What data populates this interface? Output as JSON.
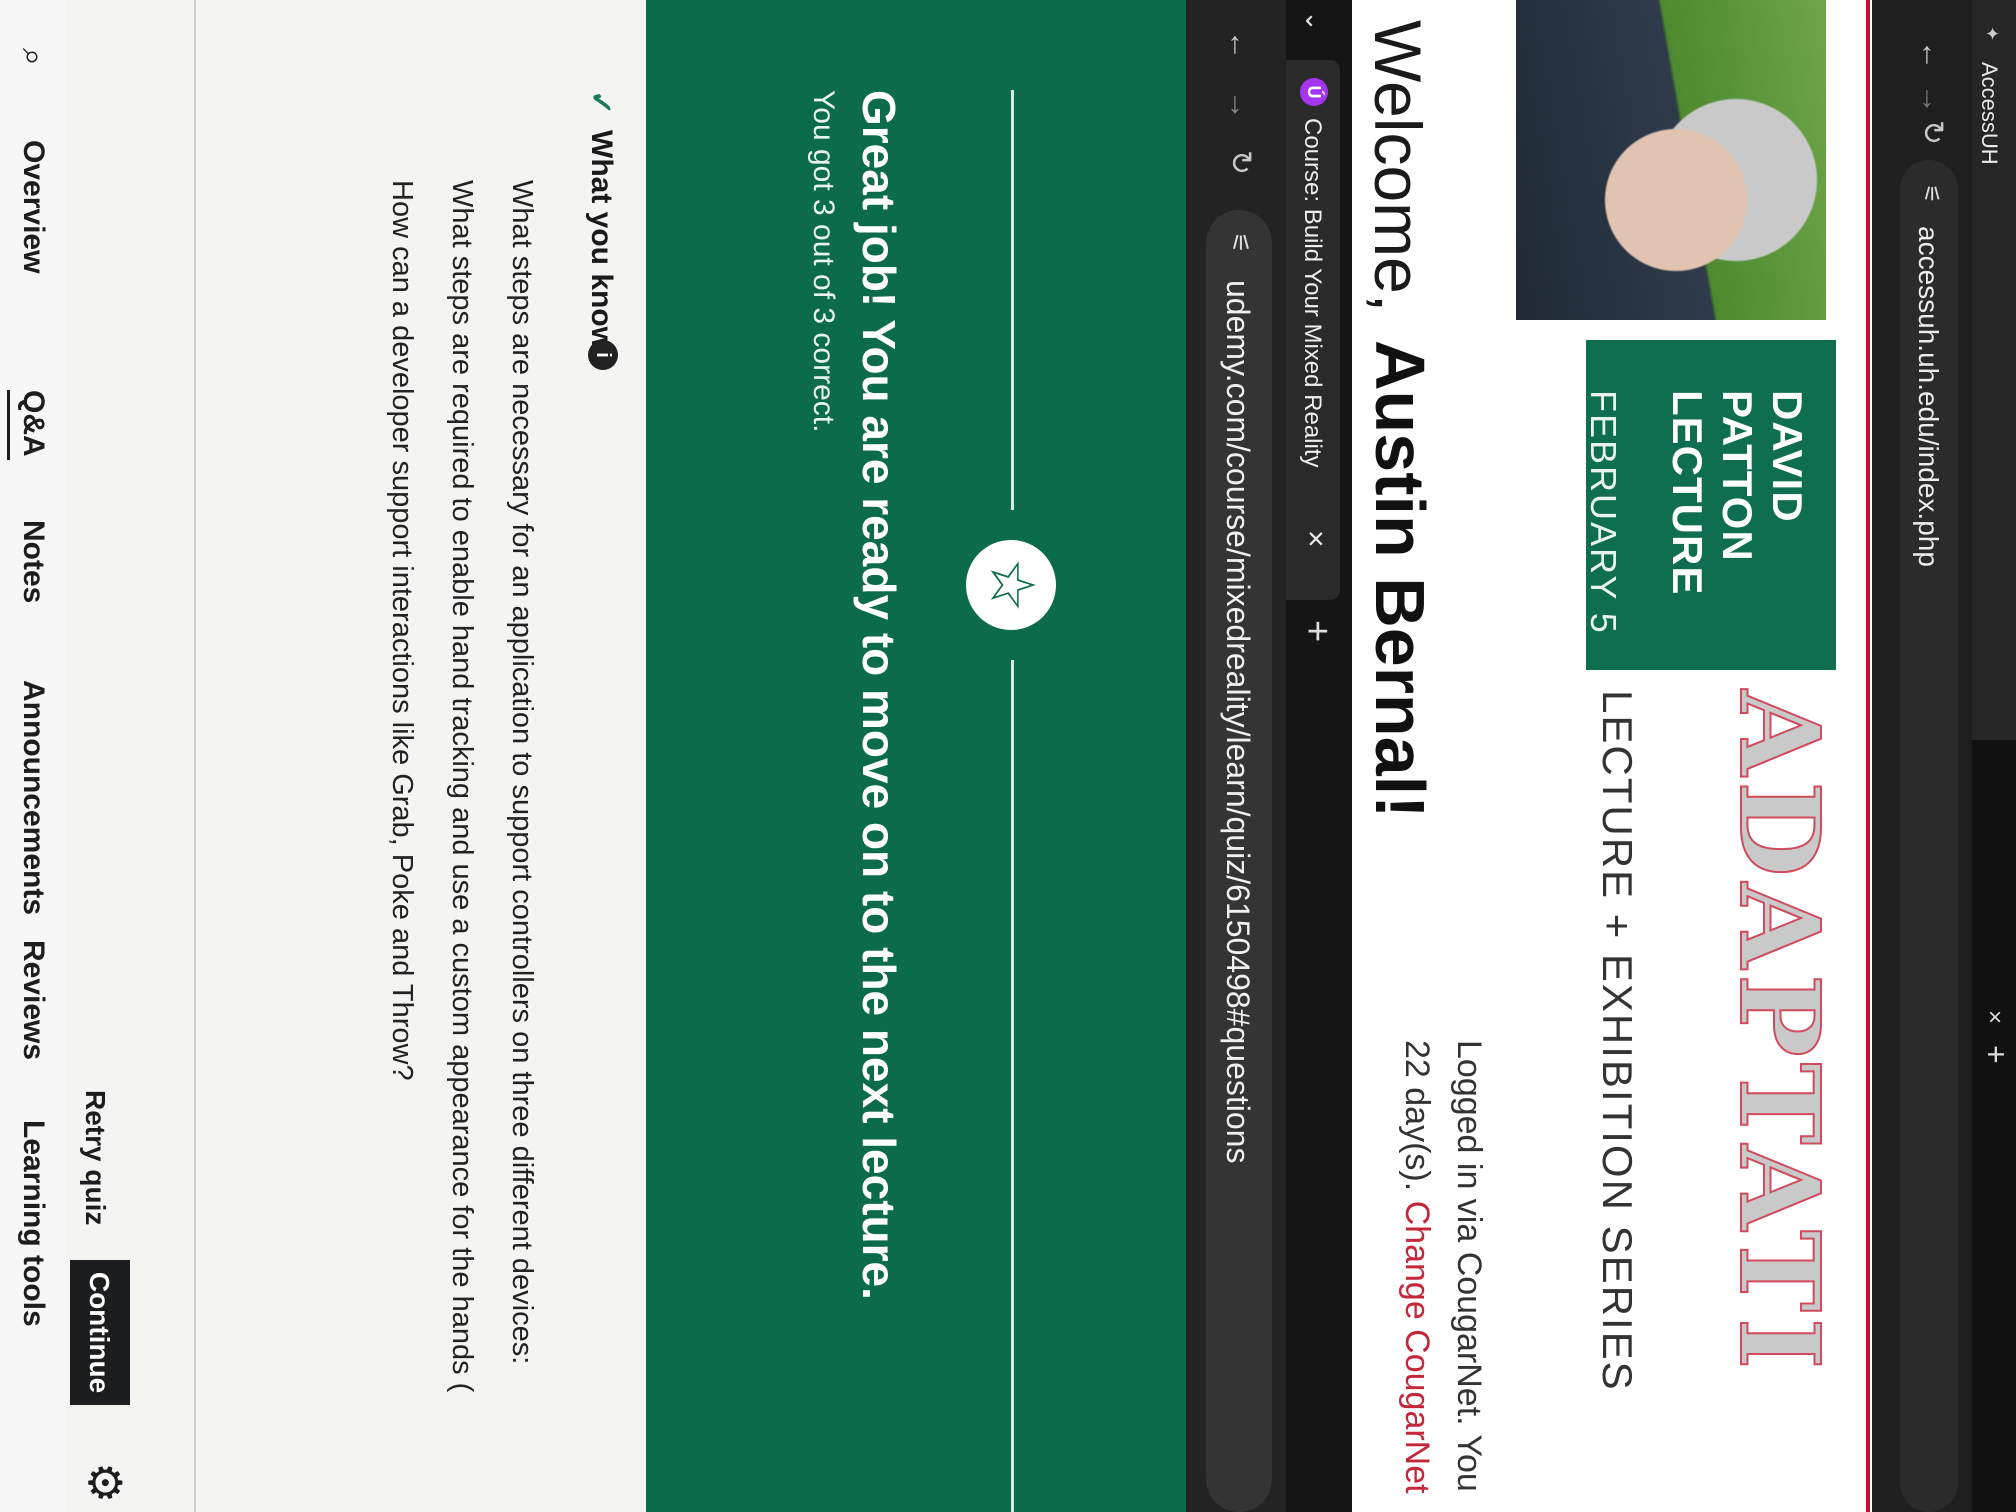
{
  "background_browser": {
    "tab_title": "AccessUH",
    "tab_close": "×",
    "new_tab": "+",
    "url": "accessuh.uh.edu/index.php",
    "promo": {
      "name_lines": [
        "DAVID",
        "PATTON",
        "LECTURE"
      ],
      "date": "FEBRUARY 5",
      "headline": "ADAPTATI",
      "series": "LECTURE + EXHIBITION SERIES"
    },
    "welcome_prefix": "Welcome,",
    "welcome_name": "Austin Bernal!",
    "login_line1": "Logged in via CougarNet. You",
    "login_line2_prefix": "22 day(s). ",
    "login_line2_link": "Change CougarNet"
  },
  "foreground_browser": {
    "tab_title": "Course: Build Your Mixed Reality",
    "tab_close": "×",
    "new_tab": "+",
    "url": "udemy.com/course/mixedreality/learn/quiz/6150498#questions"
  },
  "quiz_result": {
    "headline": "Great job! You are ready to move on to the next lecture.",
    "score": "You got 3 out of 3 correct."
  },
  "what_you_know": {
    "title": "What you know",
    "items": [
      "What steps are necessary for an application to support controllers on three different devices:",
      "What steps are required to enable hand tracking and use a custom appearance for the hands (",
      "How can a developer support interactions like Grab, Poke and Throw?"
    ]
  },
  "actions": {
    "retry": "Retry quiz",
    "continue": "Continue"
  },
  "course_tabs": [
    "Overview",
    "Q&A",
    "Notes",
    "Announcements",
    "Reviews",
    "Learning tools"
  ],
  "icons": {
    "back": "arrow-left-icon",
    "forward": "arrow-right-icon",
    "reload": "reload-icon",
    "site_settings": "tune-icon",
    "star": "star-icon",
    "gear": "gear-icon",
    "search": "search-icon",
    "info": "info-icon",
    "check": "check-icon"
  },
  "colors": {
    "udemy_green": "#0c6b4b",
    "uh_red": "#c8102e",
    "udemy_purple": "#a435f0",
    "dark_button": "#1c1d1f"
  }
}
